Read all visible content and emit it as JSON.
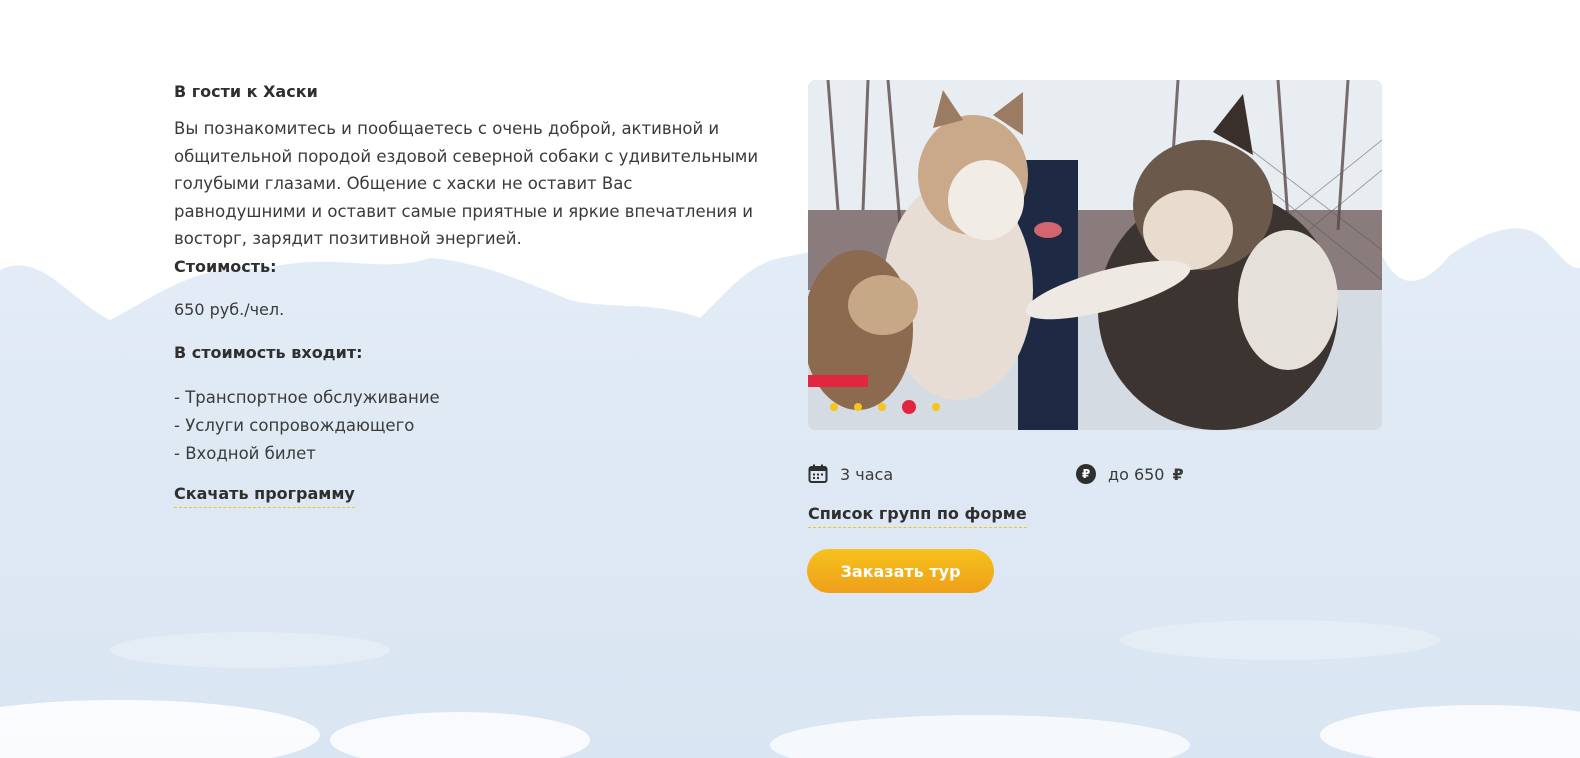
{
  "tour": {
    "title": "В гости к Хаски",
    "description": "Вы познакомитесь и пообщаетесь с очень доброй, активной и общительной породой ездовой северной собаки с удивительными голубыми глазами. Общение с хаски не оставит Вас равнодушними и оставит самые приятные и яркие впечатления и восторг, зарядит позитивной энергией.",
    "cost_label": "Стоимость:",
    "cost_value": "650 руб./чел.",
    "included_label": "В стоимость входит:",
    "included_items": [
      "- Транспортное обслуживание",
      "- Услуги сопровождающего",
      "- Входной билет"
    ],
    "download_label": "Скачать программу"
  },
  "gallery": {
    "slide_count": 5,
    "active_index": 3
  },
  "meta": {
    "duration_icon": "calendar-icon",
    "duration": "3 часа",
    "price_icon": "ruble-coin-icon",
    "price_coin_glyph": "₽",
    "price": "до 650",
    "currency": "₽"
  },
  "groups_link": "Список групп по форме",
  "order_button": "Заказать тур",
  "colors": {
    "accent_yellow": "#f5c518",
    "button_gradient_top": "#f6c21c",
    "button_gradient_bottom": "#ee9f1a",
    "active_dot": "#e3263f",
    "text": "#2f2f2f",
    "sky": "#dde8f4"
  }
}
